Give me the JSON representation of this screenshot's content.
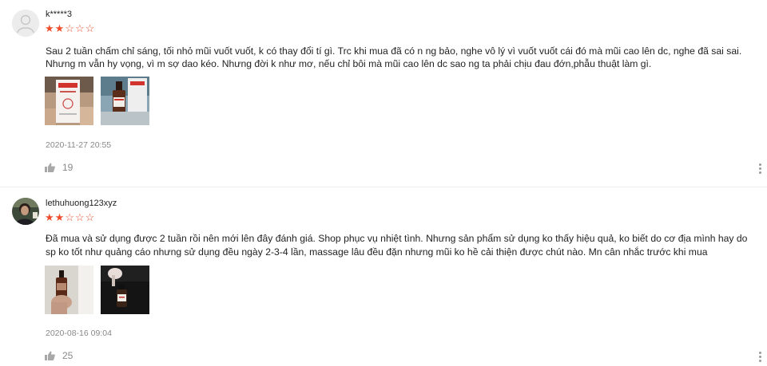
{
  "reviews": [
    {
      "username": "k*****3",
      "rating": 2,
      "text": " Sau 2 tuần chấm chỉ sáng, tối nhỏ mũi vuốt vuốt, k có thay đổi tí gì. Trc khi mua đã có n ng bảo, nghe vô lý vì vuốt vuốt cái đó mà mũi cao lên dc, nghe đã sai sai. Nhưng m vẫn hy vọng, vì m sợ dao kéo. Nhưng đời k như mơ, nếu chỉ bôi mà mũi cao lên dc sao ng ta phải chịu đau đớn,phẫu thuật làm gì.",
      "date": "2020-11-27 20:55",
      "likes": "19",
      "avatar_icon": "default-user-icon",
      "photos": [
        "product-box-photo",
        "product-bottle-photo"
      ]
    },
    {
      "username": "lethuhuong123xyz",
      "rating": 2,
      "text": "Đã mua và sử dụng được 2 tuần rồi nên mới lên đây đánh giá. Shop phục vụ nhiệt tình. Nhưng sản phẩm sử dụng ko thấy hiệu quả, ko biết do cơ địa mình hay do sp ko tốt như quảng cáo nhưng sử dụng đều ngày 2-3-4 lần, massage lâu đều đặn nhưng mũi ko hề cải thiện được chút nào. Mn cân nhắc trước khi mua",
      "date": "2020-08-16 09:04",
      "likes": "25",
      "avatar_icon": "user-photo-icon",
      "photos": [
        "bottle-in-hand-photo",
        "bottle-dark-photo"
      ]
    }
  ],
  "colors": {
    "star": "#ee4d2d",
    "muted": "#888888",
    "divider": "#ececec"
  },
  "icons": {
    "like": "thumbs-up-icon",
    "more": "more-vertical-icon",
    "star_full": "★",
    "star_empty": "☆"
  }
}
